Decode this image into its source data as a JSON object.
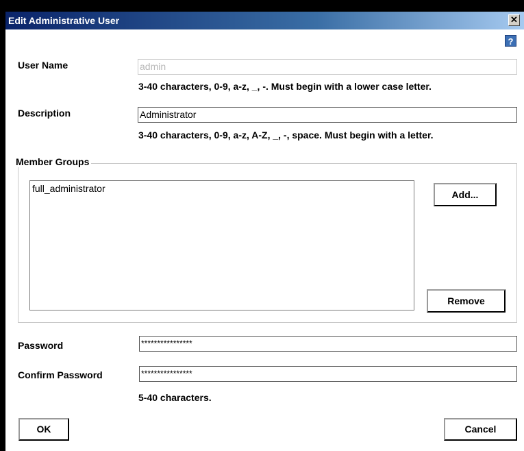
{
  "window": {
    "title": "Edit Administrative User",
    "close_glyph": "✕",
    "help_glyph": "?"
  },
  "user_name": {
    "label": "User Name",
    "value": "admin",
    "hint": "3-40 characters, 0-9, a-z, _, -. Must begin with a lower case letter."
  },
  "description": {
    "label": "Description",
    "value": "Administrator",
    "hint": "3-40 characters, 0-9, a-z, A-Z, _, -, space. Must begin with a letter."
  },
  "member_groups": {
    "legend": "Member Groups",
    "items": [
      "full_administrator"
    ],
    "add_label": "Add...",
    "remove_label": "Remove"
  },
  "password": {
    "label": "Password",
    "value": "****************"
  },
  "confirm_password": {
    "label": "Confirm Password",
    "value": "****************",
    "hint": "5-40 characters."
  },
  "buttons": {
    "ok": "OK",
    "cancel": "Cancel"
  },
  "colors": {
    "titlebar_start": "#0a246a",
    "titlebar_end": "#a6caf0",
    "disabled_text": "#b8b8b8"
  }
}
